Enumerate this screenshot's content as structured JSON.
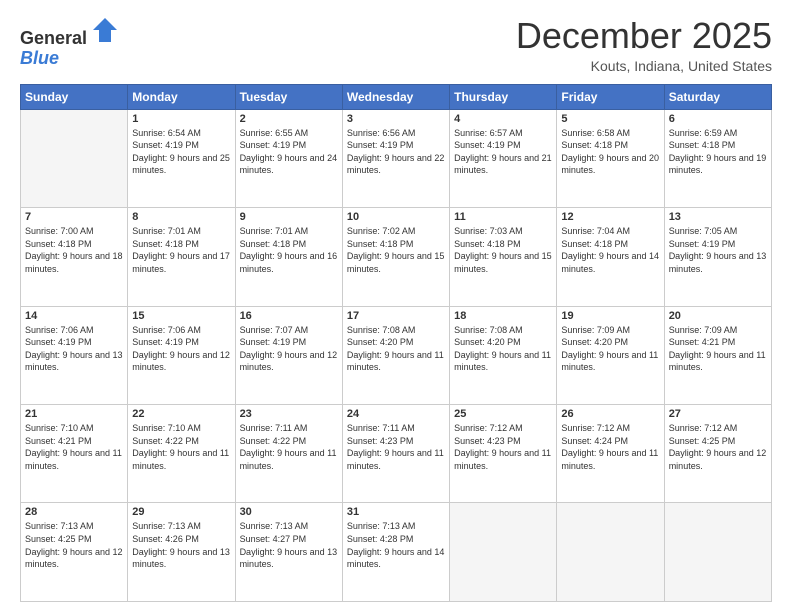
{
  "header": {
    "logo_line1": "General",
    "logo_line2": "Blue",
    "month": "December 2025",
    "location": "Kouts, Indiana, United States"
  },
  "weekdays": [
    "Sunday",
    "Monday",
    "Tuesday",
    "Wednesday",
    "Thursday",
    "Friday",
    "Saturday"
  ],
  "weeks": [
    [
      {
        "day": "",
        "empty": true
      },
      {
        "day": "1",
        "sunrise": "6:54 AM",
        "sunset": "4:19 PM",
        "daylight": "9 hours and 25 minutes."
      },
      {
        "day": "2",
        "sunrise": "6:55 AM",
        "sunset": "4:19 PM",
        "daylight": "9 hours and 24 minutes."
      },
      {
        "day": "3",
        "sunrise": "6:56 AM",
        "sunset": "4:19 PM",
        "daylight": "9 hours and 22 minutes."
      },
      {
        "day": "4",
        "sunrise": "6:57 AM",
        "sunset": "4:19 PM",
        "daylight": "9 hours and 21 minutes."
      },
      {
        "day": "5",
        "sunrise": "6:58 AM",
        "sunset": "4:18 PM",
        "daylight": "9 hours and 20 minutes."
      },
      {
        "day": "6",
        "sunrise": "6:59 AM",
        "sunset": "4:18 PM",
        "daylight": "9 hours and 19 minutes."
      }
    ],
    [
      {
        "day": "7",
        "sunrise": "7:00 AM",
        "sunset": "4:18 PM",
        "daylight": "9 hours and 18 minutes."
      },
      {
        "day": "8",
        "sunrise": "7:01 AM",
        "sunset": "4:18 PM",
        "daylight": "9 hours and 17 minutes."
      },
      {
        "day": "9",
        "sunrise": "7:01 AM",
        "sunset": "4:18 PM",
        "daylight": "9 hours and 16 minutes."
      },
      {
        "day": "10",
        "sunrise": "7:02 AM",
        "sunset": "4:18 PM",
        "daylight": "9 hours and 15 minutes."
      },
      {
        "day": "11",
        "sunrise": "7:03 AM",
        "sunset": "4:18 PM",
        "daylight": "9 hours and 15 minutes."
      },
      {
        "day": "12",
        "sunrise": "7:04 AM",
        "sunset": "4:18 PM",
        "daylight": "9 hours and 14 minutes."
      },
      {
        "day": "13",
        "sunrise": "7:05 AM",
        "sunset": "4:19 PM",
        "daylight": "9 hours and 13 minutes."
      }
    ],
    [
      {
        "day": "14",
        "sunrise": "7:06 AM",
        "sunset": "4:19 PM",
        "daylight": "9 hours and 13 minutes."
      },
      {
        "day": "15",
        "sunrise": "7:06 AM",
        "sunset": "4:19 PM",
        "daylight": "9 hours and 12 minutes."
      },
      {
        "day": "16",
        "sunrise": "7:07 AM",
        "sunset": "4:19 PM",
        "daylight": "9 hours and 12 minutes."
      },
      {
        "day": "17",
        "sunrise": "7:08 AM",
        "sunset": "4:20 PM",
        "daylight": "9 hours and 11 minutes."
      },
      {
        "day": "18",
        "sunrise": "7:08 AM",
        "sunset": "4:20 PM",
        "daylight": "9 hours and 11 minutes."
      },
      {
        "day": "19",
        "sunrise": "7:09 AM",
        "sunset": "4:20 PM",
        "daylight": "9 hours and 11 minutes."
      },
      {
        "day": "20",
        "sunrise": "7:09 AM",
        "sunset": "4:21 PM",
        "daylight": "9 hours and 11 minutes."
      }
    ],
    [
      {
        "day": "21",
        "sunrise": "7:10 AM",
        "sunset": "4:21 PM",
        "daylight": "9 hours and 11 minutes."
      },
      {
        "day": "22",
        "sunrise": "7:10 AM",
        "sunset": "4:22 PM",
        "daylight": "9 hours and 11 minutes."
      },
      {
        "day": "23",
        "sunrise": "7:11 AM",
        "sunset": "4:22 PM",
        "daylight": "9 hours and 11 minutes."
      },
      {
        "day": "24",
        "sunrise": "7:11 AM",
        "sunset": "4:23 PM",
        "daylight": "9 hours and 11 minutes."
      },
      {
        "day": "25",
        "sunrise": "7:12 AM",
        "sunset": "4:23 PM",
        "daylight": "9 hours and 11 minutes."
      },
      {
        "day": "26",
        "sunrise": "7:12 AM",
        "sunset": "4:24 PM",
        "daylight": "9 hours and 11 minutes."
      },
      {
        "day": "27",
        "sunrise": "7:12 AM",
        "sunset": "4:25 PM",
        "daylight": "9 hours and 12 minutes."
      }
    ],
    [
      {
        "day": "28",
        "sunrise": "7:13 AM",
        "sunset": "4:25 PM",
        "daylight": "9 hours and 12 minutes."
      },
      {
        "day": "29",
        "sunrise": "7:13 AM",
        "sunset": "4:26 PM",
        "daylight": "9 hours and 13 minutes."
      },
      {
        "day": "30",
        "sunrise": "7:13 AM",
        "sunset": "4:27 PM",
        "daylight": "9 hours and 13 minutes."
      },
      {
        "day": "31",
        "sunrise": "7:13 AM",
        "sunset": "4:28 PM",
        "daylight": "9 hours and 14 minutes."
      },
      {
        "day": "",
        "empty": true
      },
      {
        "day": "",
        "empty": true
      },
      {
        "day": "",
        "empty": true
      }
    ]
  ]
}
